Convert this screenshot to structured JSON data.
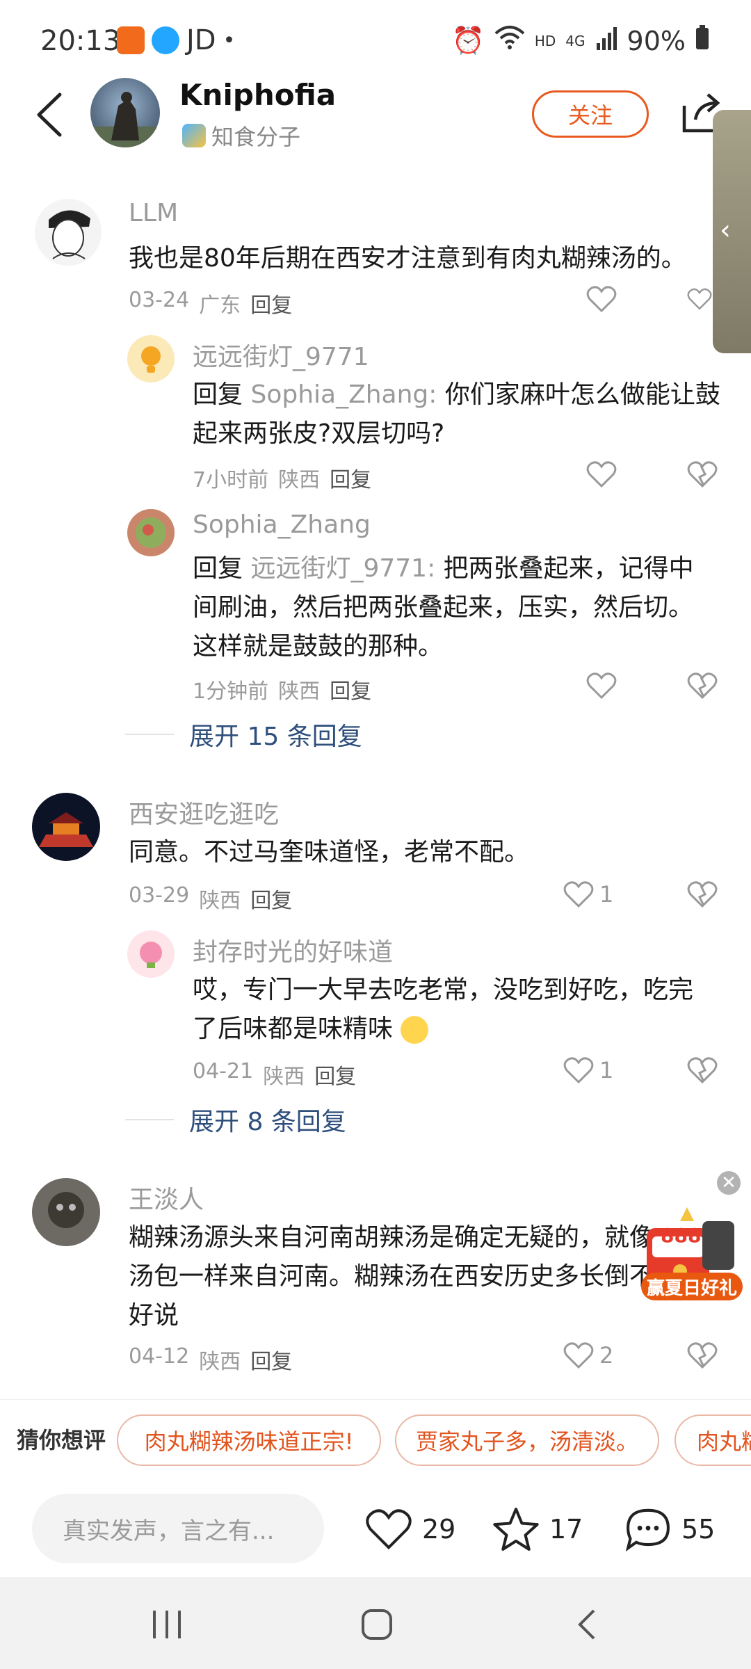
{
  "status_bar": {
    "time": "20:13",
    "carrier_text": "JD",
    "dot": "•",
    "hd": "HD",
    "net": "4G",
    "battery": "90%"
  },
  "header": {
    "name": "Kniphofia",
    "tag": "知食分子",
    "follow_label": "关注"
  },
  "reply_label": "回复",
  "comments": [
    {
      "name": "LLM",
      "text": "我也是80年后期在西安才注意到有肉丸糊辣汤的。",
      "date": "03-24",
      "region": "广东",
      "likes": ""
    },
    {
      "name": "远远街灯_9771",
      "reply_prefix": "回复",
      "reply_to": "Sophia_Zhang:",
      "text": "你们家麻叶怎么做能让鼓起来两张皮?双层切吗?",
      "line2": "起来两张皮?双层切吗?",
      "line1": "你们家麻叶怎么做能让鼓",
      "date": "7小时前",
      "region": "陕西",
      "likes": ""
    },
    {
      "name": "Sophia_Zhang",
      "reply_prefix": "回复",
      "reply_to": "远远街灯_9771:",
      "line1": "把两张叠起来，记得中",
      "line2": "间刷油，然后把两张叠起来，压实，然后切。",
      "line3": "这样就是鼓鼓的那种。",
      "date": "1分钟前",
      "region": "陕西",
      "likes": ""
    },
    {
      "name": "西安逛吃逛吃",
      "text": "同意。不过马奎味道怪，老常不配。",
      "date": "03-29",
      "region": "陕西",
      "likes": "1"
    },
    {
      "name": "封存时光的好味道",
      "line1": "哎，专门一大早去吃老常，没吃到好吃，吃完",
      "line2": "了后味都是味精味",
      "date": "04-21",
      "region": "陕西",
      "likes": "1"
    },
    {
      "name": "王淡人",
      "line1": "糊辣汤源头来自河南胡辣汤是确定无疑的，就像",
      "line2": "汤包一样来自河南。糊辣汤在西安历史多长倒不",
      "line3": "好说",
      "date": "04-12",
      "region": "陕西",
      "likes": "2"
    }
  ],
  "expand1": "展开 15 条回复",
  "expand2": "展开 8 条回复",
  "promo": {
    "number": "888",
    "label": "赢夏日好礼"
  },
  "suggestions": {
    "label": "猜你想评",
    "chips": [
      "肉丸糊辣汤味道正宗!",
      "贾家丸子多，汤清淡。",
      "肉丸糊"
    ]
  },
  "bottom": {
    "input_placeholder": "真实发声，言之有...",
    "likes": "29",
    "favorites": "17",
    "comments": "55"
  },
  "colors": {
    "accent": "#e85a1f",
    "link": "#2e4f7c"
  }
}
